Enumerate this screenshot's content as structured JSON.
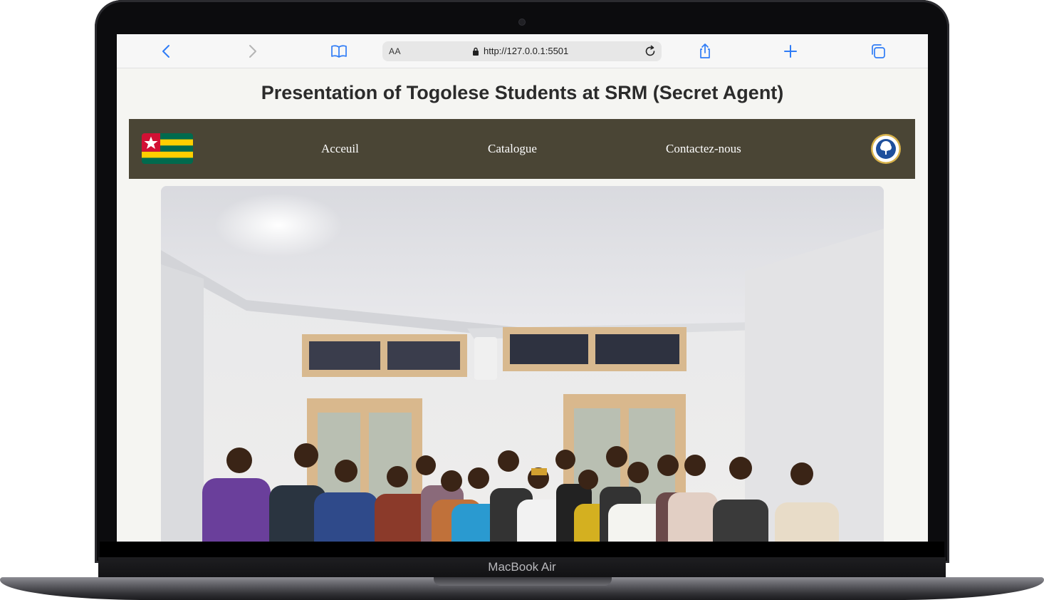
{
  "device": {
    "label": "MacBook Air"
  },
  "browser": {
    "text_size_label": "AA",
    "url": "http://127.0.0.1:5501"
  },
  "page": {
    "title": "Presentation of Togolese Students at SRM (Secret Agent)",
    "nav": {
      "links": [
        "Acceuil",
        "Catalogue",
        "Contactez-nous"
      ],
      "background_color": "#4a4535"
    },
    "colors": {
      "flag_red": "#d21034",
      "flag_green": "#006a4e",
      "flag_yellow": "#ffce00"
    }
  }
}
